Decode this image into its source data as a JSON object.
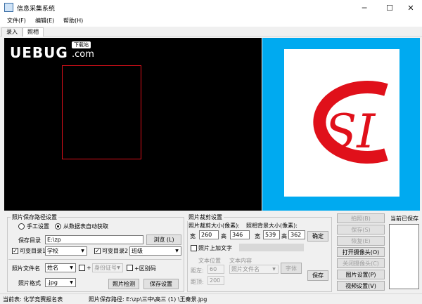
{
  "window": {
    "title": "信息采集系统",
    "minimize_glyph": "─",
    "maximize_glyph": "☐",
    "close_glyph": "✕"
  },
  "menu": [
    {
      "label": "文件(F)"
    },
    {
      "label": "编辑(E)"
    },
    {
      "label": "帮助(H)"
    }
  ],
  "tabs": [
    {
      "label": "录入"
    },
    {
      "label": "照相"
    }
  ],
  "watermark": {
    "text": "UEBUG",
    "suffix": ".com",
    "badge": "下载站"
  },
  "photo_preview": {
    "logo_text": "SI",
    "background_color": "#00aaf0",
    "logo_color": "#e0101a"
  },
  "save_path": {
    "title": "照片保存路径设置",
    "manual_label": "手工设置",
    "auto_label": "从数据表自动获取",
    "auto_selected": true,
    "dir_label": "保存目录",
    "dir_value": "E:\\zp",
    "browse_label": "浏览 (L)",
    "var_dir1_label": "可变目录1",
    "var_dir1_value": "学校",
    "var_dir1_checked": true,
    "var_dir2_label": "可变目录2",
    "var_dir2_value": "班级",
    "var_dir2_checked": true,
    "filename_label": "照片文件名",
    "filename_value": "姓名",
    "plus1": "+",
    "plus2": "+",
    "id_value": "身份证号",
    "distinguish_label": "+区别码",
    "format_label": "照片格式",
    "format_value": ".jpg",
    "check_btn": "照片检测",
    "save_btn": "保存设置"
  },
  "crop": {
    "title": "照片裁剪设置",
    "crop_size_label": "照片裁剪大小(像素):",
    "bg_size_label": "照相背景大小(像素):",
    "width_label": "宽",
    "height_label": "高",
    "crop_w": "260",
    "crop_h": "346",
    "bg_w": "539",
    "bg_h": "362",
    "confirm_btn": "确定",
    "add_text_label": "照片上加文字",
    "text_pos_label": "文本位置",
    "text_content_label": "文本内容",
    "left_label": "距左:",
    "top_label": "距顶:",
    "left_value": "60",
    "top_value": "200",
    "content_value": "照片文件名",
    "font_btn": "字体",
    "save_btn": "保存"
  },
  "camera": {
    "photo_btn": "拍照(B)",
    "save_btn": "保存(S)",
    "restore_btn": "恢复(E)",
    "open_cam_btn": "打开摄像头(O)",
    "close_cam_btn": "关闭摄像头(C)",
    "image_settings_btn": "图片设置(P)",
    "video_settings_btn": "视频设置(V)",
    "saved_label": "当前已保存"
  },
  "status": {
    "table": "当前表: 化学竞赛报名表",
    "path": "照片保存路径: E:\\zp\\三中\\高三 (1) \\王秦景.jpg"
  }
}
